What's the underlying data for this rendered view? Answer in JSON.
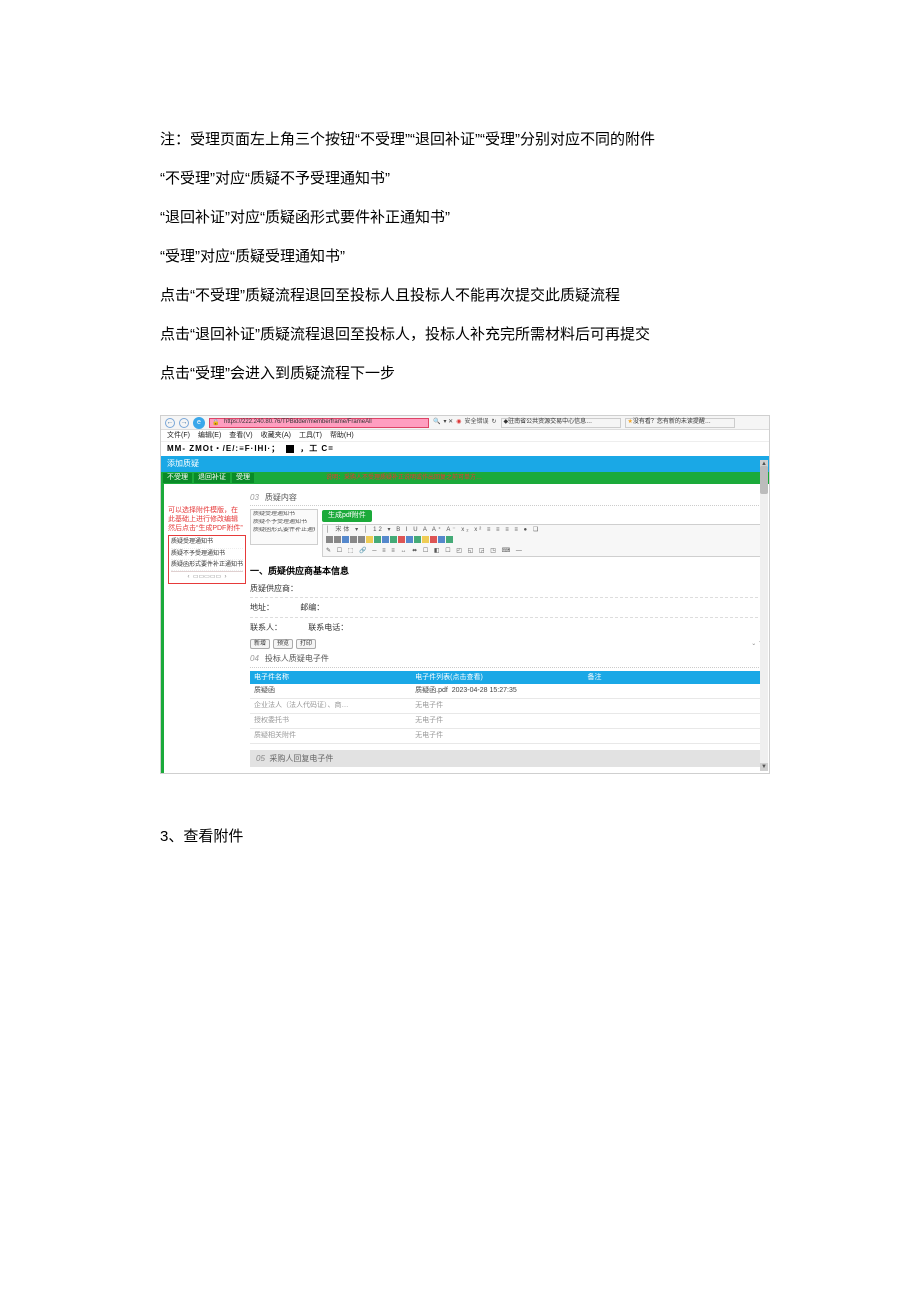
{
  "doc": {
    "paragraphs": [
      "注：受理页面左上角三个按钮“不受理”“退回补证”“受理”分别对应不同的附件",
      "“不受理”对应“质疑不予受理通知书”",
      "“退回补证”对应“质疑函形式要件补正通知书”",
      "“受理”对应“质疑受理通知书”",
      "点击“不受理”质疑流程退回至投标人且投标人不能再次提交此质疑流程",
      "点击“退回补证”质疑流程退回至投标人，投标人补充完所需材料后可再提交",
      "点击“受理”会进入到质疑流程下一步"
    ],
    "footer": "3、查看附件"
  },
  "shot": {
    "addr_url": "https://222.240.80.76/TPBidder/memberframe/FrameAll",
    "search_hint": "安全错误",
    "tab1": "驻南省公共资源交易中心信息…",
    "tab2": "没有看？您有新的未读提醒…",
    "menus": [
      "文件(F)",
      "编辑(E)",
      "查看(V)",
      "收藏夹(A)",
      "工具(T)",
      "帮助(H)"
    ],
    "brand": "MM- ZMOt・/E/:≡F·IHI·；",
    "brand_tail": "，工  C=",
    "blue_title": "添加质疑",
    "green_btns": [
      "不受理",
      "退回补证",
      "受理"
    ],
    "green_note": "说明：采购人不受理质疑补正说明或作出回复之前可单方…",
    "callout": [
      "可以选择附件模版，在",
      "此基础上进行修改编辑",
      "然后点击“生成PDF附件”"
    ],
    "redbox_items": [
      "质疑受理通知书",
      "质疑不予受理通知书",
      "质疑函形式要件补正通知书"
    ],
    "section03": "质疑内容",
    "gen_btn": "生成pdf附件",
    "ed_sidebar": [
      "质疑受理通知书",
      "质疑不予受理通知书",
      "质疑函形式要件补正通知"
    ],
    "toolbar_rows": [
      "│ 宋体 ▾ │ 12 ▾  B  I  U  A  A⁺ A⁻ x₂ x²  ≡ ≡ ≡ ≡  ●  ❏",
      "↶ ↷ △ ☒ ☐ ❐ ✎ 📎 🖨 🔍 🔎 📷 ☑ ☒ ▦ 🔳 🛑 🔵",
      "✎ ☐ ⬚ 🔗 ─ ≡ ≡ ↔ ⬌ ☐ ◧ ☐ ◰ ◱ ◲ ◳ ⌨ —"
    ],
    "subhead": "一、质疑供应商基本信息",
    "form": {
      "supplier_label": "质疑供应商：",
      "addr_label": "地址：",
      "post_label": "邮编：",
      "contact_label": "联系人：",
      "phone_label": "联系电话："
    },
    "mini_btns": [
      "新增",
      "预览",
      "打印"
    ],
    "section04": "投标人质疑电子件",
    "att_headers": [
      "电子件名称",
      "电子件列表(点击查看)",
      "备注"
    ],
    "att_rows": [
      {
        "c1": "质疑函",
        "c2": "质疑函.pdf",
        "c3": "2023-04-28 15:27:35"
      },
      {
        "c1": "企业法人（法人代码证）、商…",
        "c2": "无电子件",
        "c3": ""
      },
      {
        "c1": "授权委托书",
        "c2": "无电子件",
        "c3": ""
      },
      {
        "c1": "质疑相关附件",
        "c2": "无电子件",
        "c3": ""
      }
    ],
    "section05": "采购人回复电子件"
  }
}
